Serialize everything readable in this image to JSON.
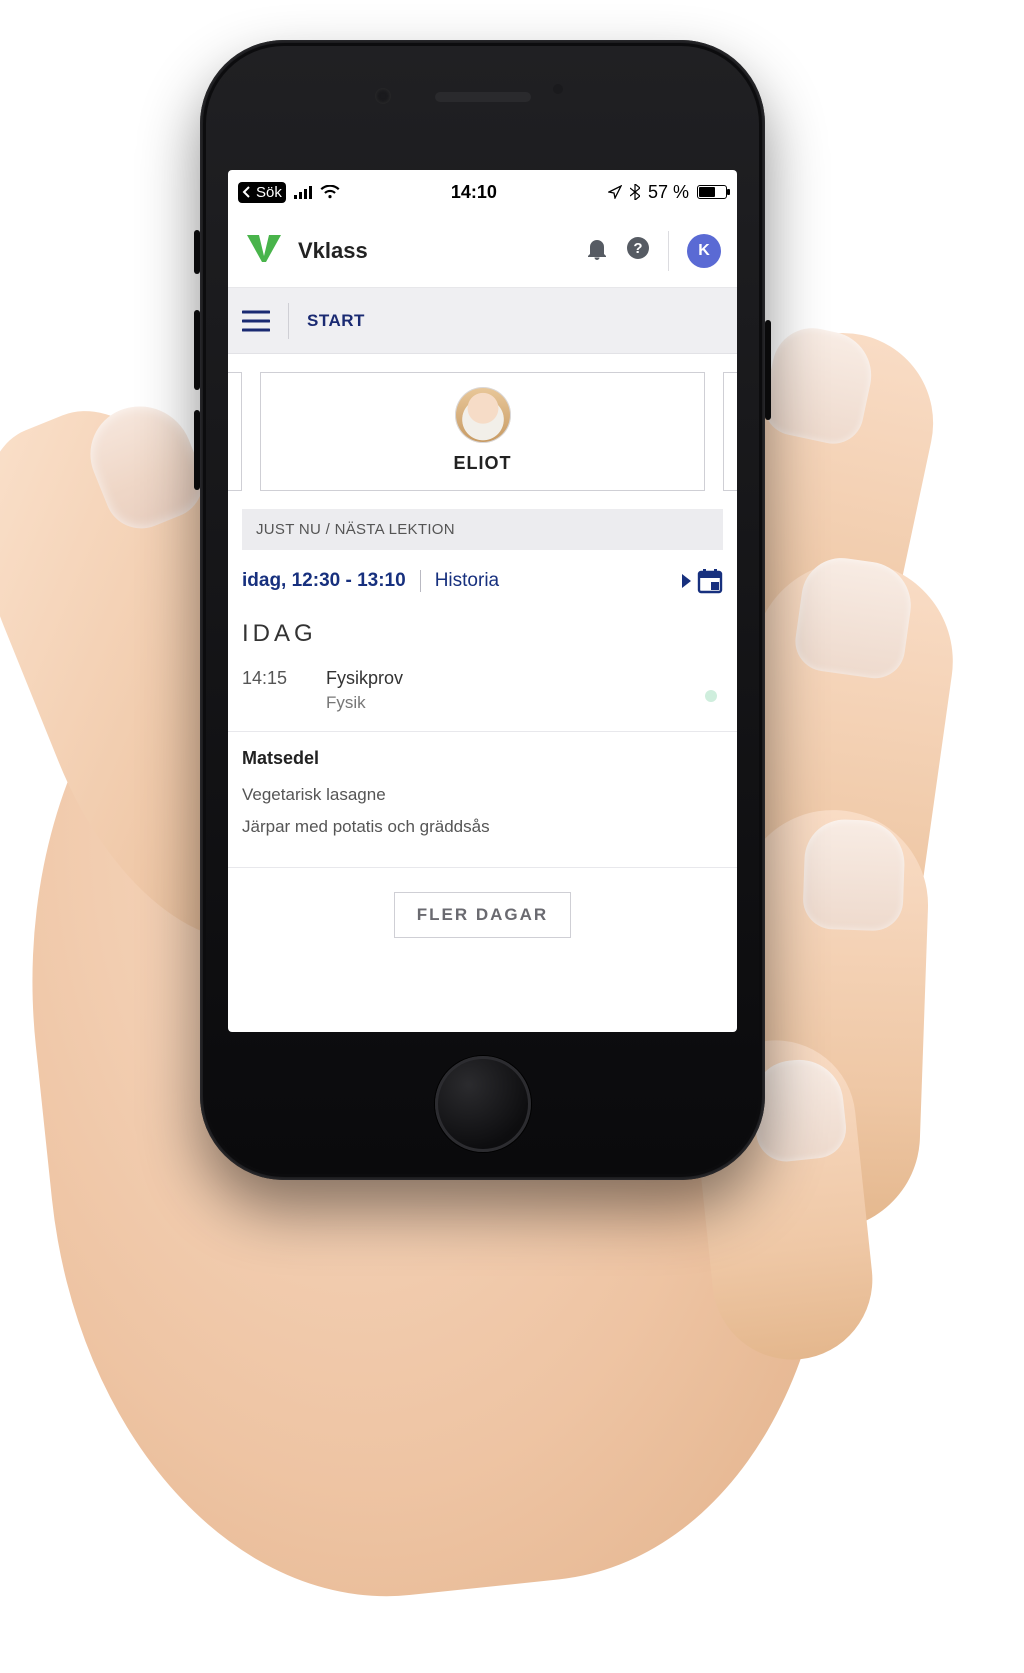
{
  "statusbar": {
    "back_label": "Sök",
    "time": "14:10",
    "battery_pct": "57 %"
  },
  "header": {
    "app_name": "Vklass",
    "avatar_initial": "K"
  },
  "subheader": {
    "crumb": "START"
  },
  "student": {
    "name": "ELIOT"
  },
  "section": {
    "now_next": "JUST NU / NÄSTA LEKTION"
  },
  "lesson": {
    "time": "idag, 12:30 - 13:10",
    "subject": "Historia"
  },
  "today": {
    "title": "IDAG",
    "events": [
      {
        "time": "14:15",
        "title": "Fysikprov",
        "subject": "Fysik"
      }
    ]
  },
  "menu": {
    "title": "Matsedel",
    "items": [
      "Vegetarisk lasagne",
      "Järpar med potatis och gräddsås"
    ]
  },
  "actions": {
    "more_days": "FLER DAGAR"
  }
}
